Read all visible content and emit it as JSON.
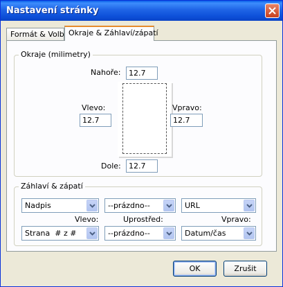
{
  "window": {
    "title": "Nastavení stránky",
    "close_icon": "close-icon"
  },
  "tabs": [
    {
      "label": "Formát & Volby",
      "active": false
    },
    {
      "label": "Okraje & Záhlaví/zápatí",
      "active": true
    }
  ],
  "margins": {
    "group_label": "Okraje (milimetry)",
    "top": {
      "label": "Nahoře:",
      "value": "12.7"
    },
    "left": {
      "label": "Vlevo:",
      "value": "12.7"
    },
    "right": {
      "label": "Vpravo:",
      "value": "12.7"
    },
    "bottom": {
      "label": "Dole:",
      "value": "12.7"
    }
  },
  "headers_footers": {
    "group_label": "Záhlaví & zápatí",
    "header_left": "Nadpis",
    "header_center": "--prázdno--",
    "header_right": "URL",
    "label_left": "Vlevo:",
    "label_center": "Uprostřed:",
    "label_right": "Vpravo:",
    "footer_left": "Strana  # z #",
    "footer_center": "--prázdno--",
    "footer_right": "Datum/čas"
  },
  "buttons": {
    "ok": "OK",
    "cancel": "Zrušit"
  },
  "colors": {
    "titlebar": "#0a5ee8",
    "active_tab_accent": "#e68b2c",
    "dialog_bg": "#ece9d8"
  }
}
